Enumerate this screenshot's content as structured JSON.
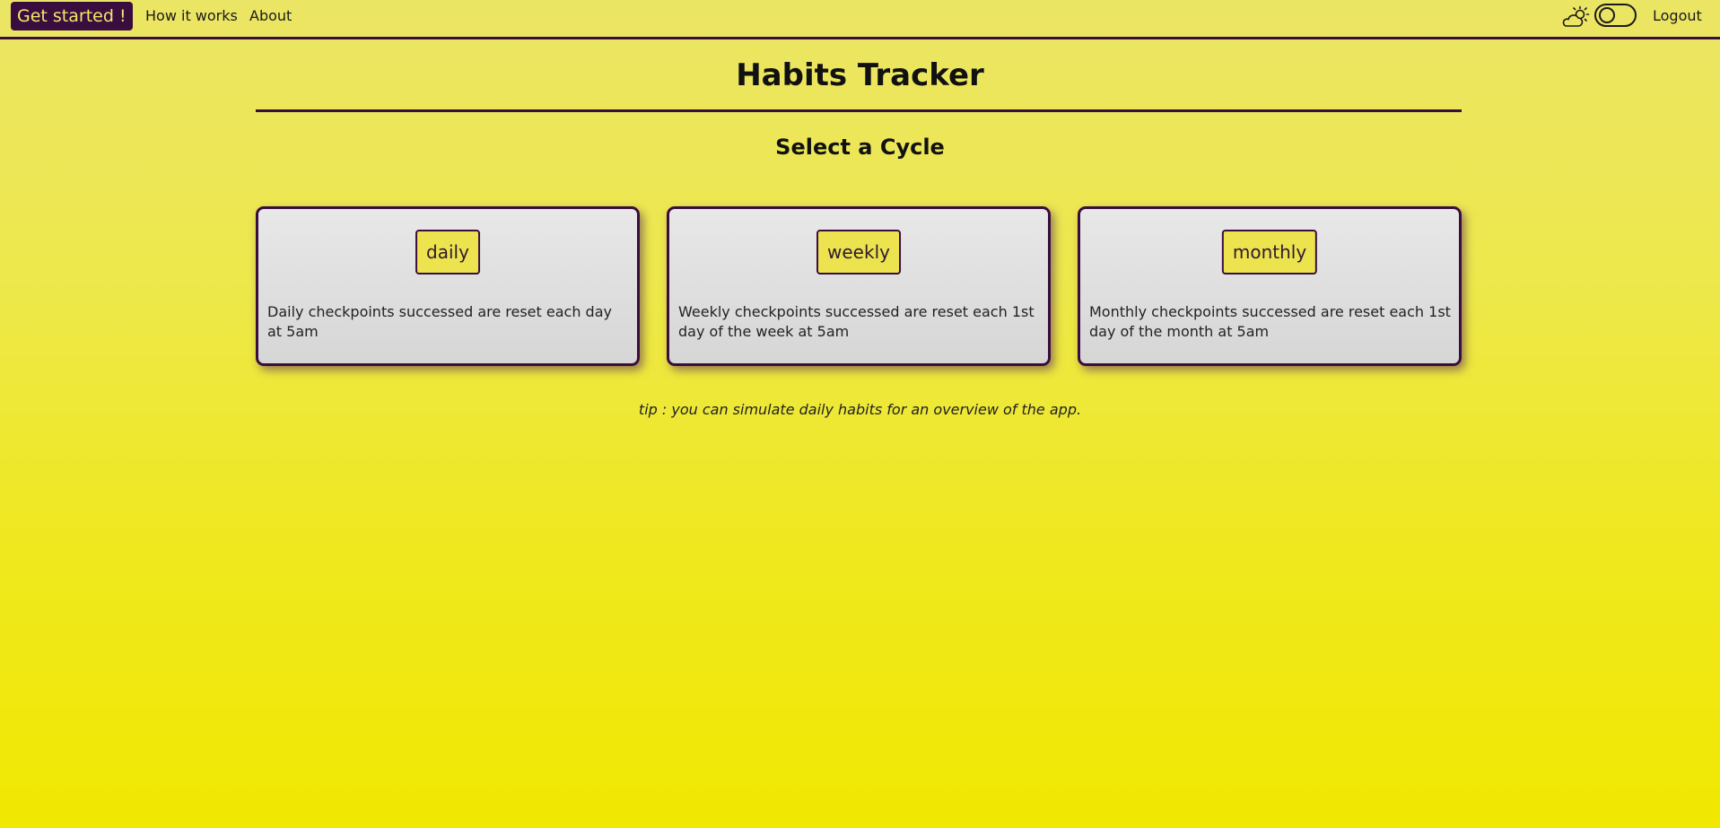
{
  "nav": {
    "cta_label": "Get started !",
    "how_label": "How it works",
    "about_label": "About",
    "theme_icon": "cloud-sun-icon",
    "logout_label": "Logout"
  },
  "main": {
    "title": "Habits Tracker",
    "subtitle": "Select a Cycle",
    "cycles": [
      {
        "label": "daily",
        "description": "Daily checkpoints successed are reset each day at 5am"
      },
      {
        "label": "weekly",
        "description": "Weekly checkpoints successed are reset each 1st day of the week at 5am"
      },
      {
        "label": "monthly",
        "description": "Monthly checkpoints successed are reset each 1st day of the month at 5am"
      }
    ],
    "tip": "tip : you can simulate daily habits for an overview of the app."
  },
  "colors": {
    "accent": "#3a0d3f",
    "background_top": "#ebe565",
    "background_bottom": "#f0e800",
    "button_fill": "#ece34f",
    "card_fill": "#e0e0e0"
  }
}
